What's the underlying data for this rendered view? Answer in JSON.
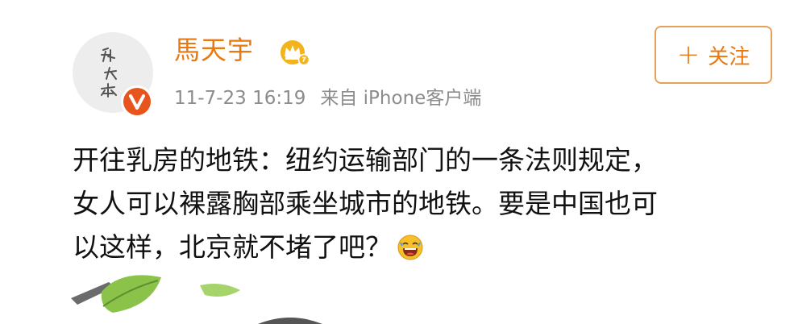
{
  "post": {
    "author": {
      "name": "馬天宇",
      "avatar_icon": "calligraphy-avatar",
      "verified_icon": "verified-v-icon",
      "vip_icon": "crown-vip-icon"
    },
    "time": "11-7-23 16:19",
    "source": "来自 iPhone客户端",
    "follow_button": {
      "plus": "+",
      "label": "关注"
    },
    "content_lines": [
      "开往乳房的地铁：纽约运输部门的一条法则规定，",
      "女人可以裸露胸部乘坐城市的地铁。要是中国也可",
      "以这样，北京就不堵了吧？"
    ],
    "emoji": "laughing-face-emoji"
  },
  "colors": {
    "username": "#e8780f",
    "meta": "#8c8c8c",
    "button_border": "#e8a15b",
    "verified": "#e8541e",
    "text": "#111111"
  }
}
